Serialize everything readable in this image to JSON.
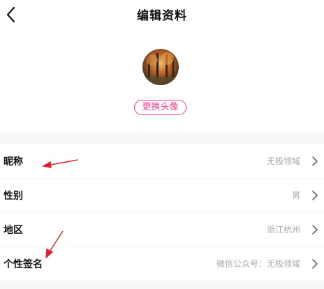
{
  "header": {
    "title": "编辑资料"
  },
  "avatar": {
    "change_label": "更换头像"
  },
  "profile_rows": [
    {
      "label": "昵称",
      "value": "无极领域"
    },
    {
      "label": "性别",
      "value": "男"
    },
    {
      "label": "地区",
      "value": "浙江杭州"
    },
    {
      "label": "个性签名",
      "value": "微信公众号：无极领域"
    }
  ],
  "colors": {
    "accent": "#ee3c8c",
    "annotation_arrow": "#d9232e",
    "secondary_text": "#a8a8a8"
  },
  "icons": {
    "back": "chevron-left-icon",
    "row_arrow": "chevron-right-icon"
  }
}
